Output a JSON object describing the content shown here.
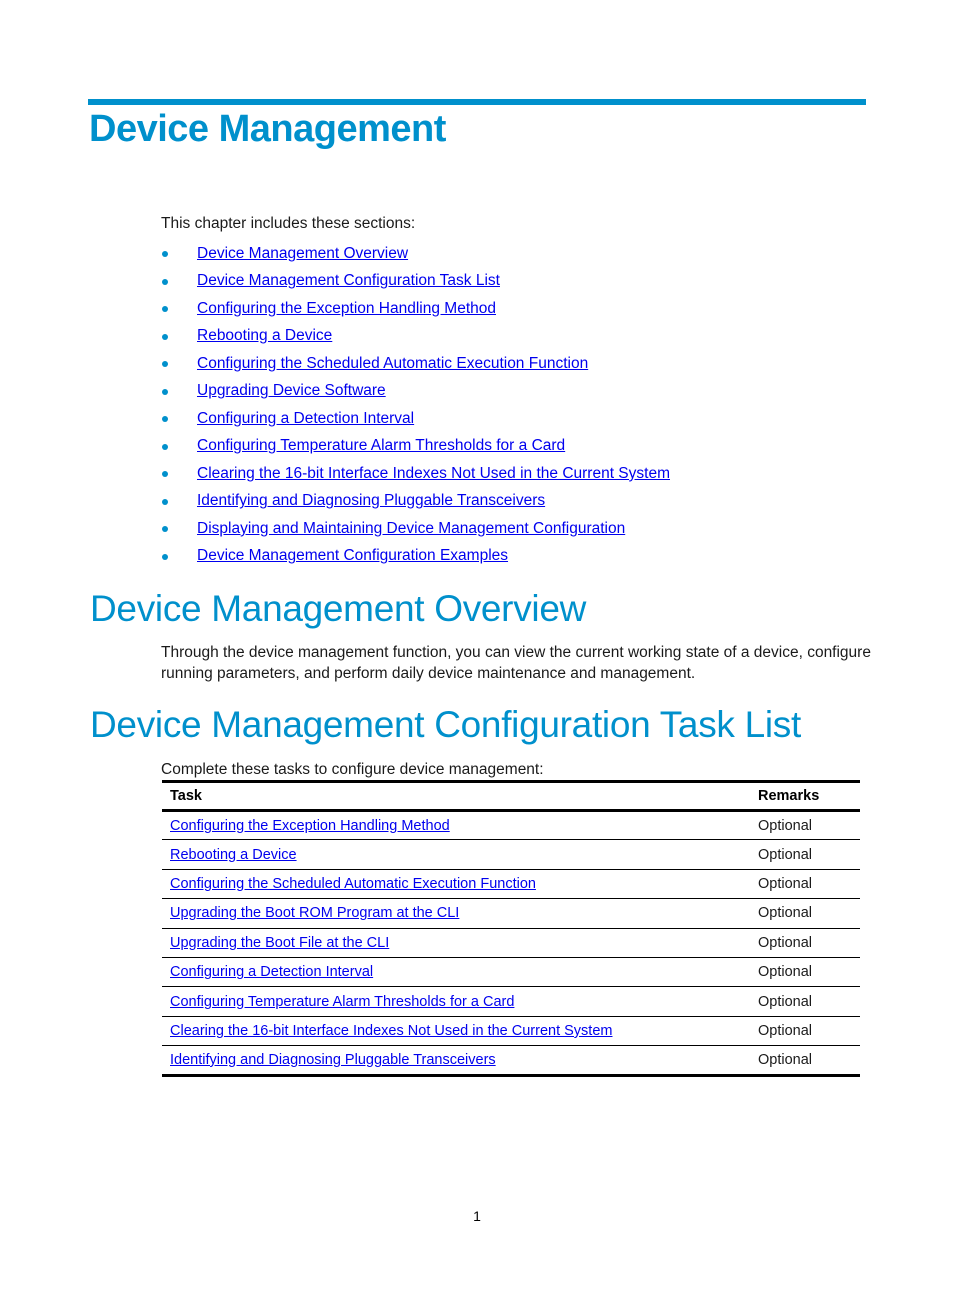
{
  "chapter": {
    "title": "Device Management",
    "intro": "This chapter includes these sections:",
    "sections": [
      "Device Management Overview",
      "Device Management Configuration Task List",
      "Configuring the Exception Handling Method",
      "Rebooting a Device",
      "Configuring the Scheduled Automatic Execution Function",
      "Upgrading Device Software",
      "Configuring a Detection Interval",
      "Configuring Temperature Alarm Thresholds for a Card",
      "Clearing the 16-bit Interface Indexes Not Used in the Current System",
      "Identifying and Diagnosing Pluggable Transceivers",
      "Displaying and Maintaining Device Management Configuration",
      "Device Management Configuration Examples"
    ]
  },
  "overview": {
    "heading": "Device Management Overview",
    "text": "Through the device management function, you can view the current working state of a device, configure running parameters, and perform daily device maintenance and management."
  },
  "task_list": {
    "heading": "Device Management Configuration Task List",
    "intro": "Complete these tasks to configure device management:",
    "columns": [
      "Task",
      "Remarks"
    ],
    "rows": [
      {
        "task": "Configuring the Exception Handling Method",
        "remarks": "Optional"
      },
      {
        "task": "Rebooting a Device",
        "remarks": "Optional"
      },
      {
        "task": "Configuring the Scheduled Automatic Execution Function",
        "remarks": "Optional"
      },
      {
        "task": "Upgrading the Boot ROM Program at the CLI",
        "remarks": "Optional"
      },
      {
        "task": "Upgrading the Boot File at the CLI",
        "remarks": "Optional"
      },
      {
        "task": "Configuring a Detection Interval",
        "remarks": "Optional"
      },
      {
        "task": "Configuring Temperature Alarm Thresholds for a Card",
        "remarks": "Optional"
      },
      {
        "task": "Clearing the 16-bit Interface Indexes Not Used in the Current System",
        "remarks": "Optional"
      },
      {
        "task": "Identifying and Diagnosing Pluggable Transceivers",
        "remarks": "Optional"
      }
    ]
  },
  "footer": {
    "page_number": "1"
  },
  "colors": {
    "accent": "#0090cc",
    "link": "#0000ee",
    "text": "#1a1a1a"
  }
}
